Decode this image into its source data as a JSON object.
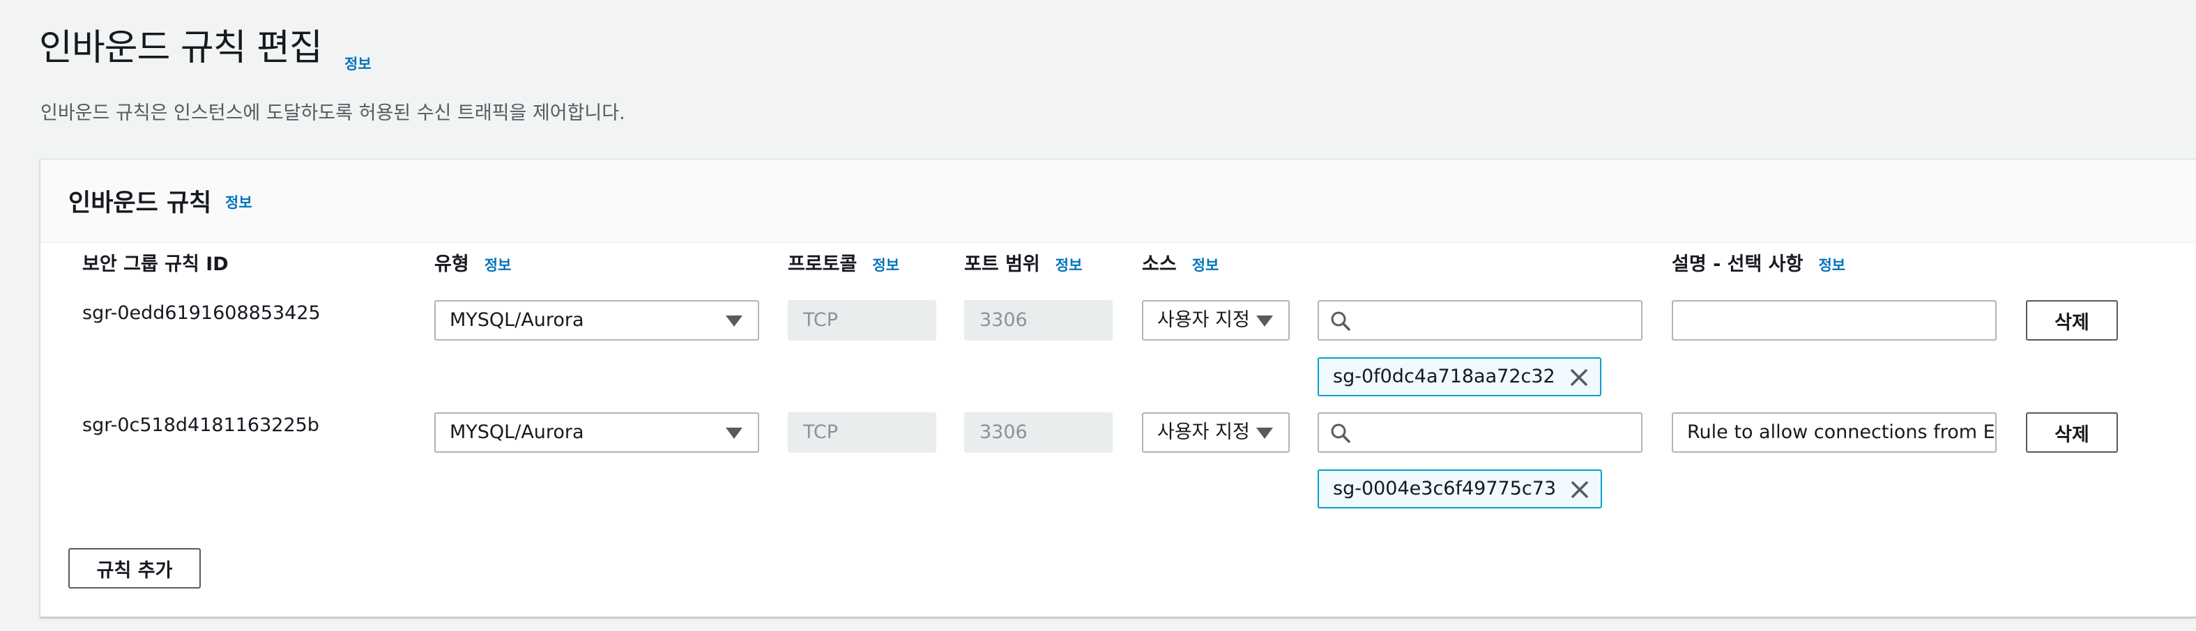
{
  "page": {
    "title": "인바운드 규칙 편집",
    "info_link": "정보",
    "description": "인바운드 규칙은 인스턴스에 도달하도록 허용된 수신 트래픽을 제어합니다."
  },
  "panel": {
    "title": "인바운드 규칙",
    "info_link": "정보"
  },
  "columns": {
    "rule_id": "보안 그룹 규칙 ID",
    "type": "유형",
    "protocol": "프로토콜",
    "port_range": "포트 범위",
    "source": "소스",
    "description": "설명 - 선택 사항",
    "info_link": "정보"
  },
  "rules": [
    {
      "id": "sgr-0edd6191608853425",
      "type": "MYSQL/Aurora",
      "protocol": "TCP",
      "port_range": "3306",
      "source_type": "사용자 지정",
      "source_search": "",
      "source_token": "sg-0f0dc4a718aa72c32",
      "description": "",
      "delete_label": "삭제"
    },
    {
      "id": "sgr-0c518d4181163225b",
      "type": "MYSQL/Aurora",
      "protocol": "TCP",
      "port_range": "3306",
      "source_type": "사용자 지정",
      "source_search": "",
      "source_token": "sg-0004e3c6f49775c73",
      "description": "Rule to allow connections from EC",
      "delete_label": "삭제"
    }
  ],
  "add_rule_label": "규칙 추가",
  "icons": {
    "caret": "caret-down-icon",
    "search": "search-icon",
    "dismiss": "close-icon"
  },
  "colors": {
    "link": "#0073bb",
    "token_border": "#00a1c9",
    "token_bg": "#f1faff"
  }
}
